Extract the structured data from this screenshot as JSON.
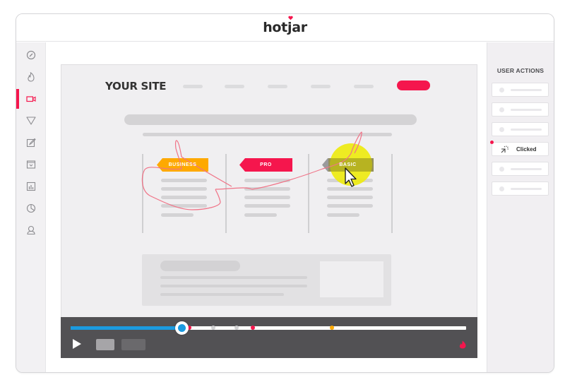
{
  "app": {
    "logo_text_pre": "hot",
    "logo_text_j": "j",
    "logo_text_post": "ar",
    "brand_color": "#f5164d"
  },
  "sidebar": {
    "items": [
      {
        "icon": "dashboard-gauge-icon",
        "active": false
      },
      {
        "icon": "heatmap-flame-icon",
        "active": false
      },
      {
        "icon": "recordings-camera-icon",
        "active": true
      },
      {
        "icon": "funnel-icon",
        "active": false
      },
      {
        "icon": "form-edit-icon",
        "active": false
      },
      {
        "icon": "poll-icon",
        "active": false
      },
      {
        "icon": "bar-chart-icon",
        "active": false
      },
      {
        "icon": "pie-chart-icon",
        "active": false
      },
      {
        "icon": "user-icon",
        "active": false
      }
    ]
  },
  "site": {
    "title": "YOUR SITE",
    "plans": [
      {
        "label": "BUSINESS",
        "color": "#fea900"
      },
      {
        "label": "PRO",
        "color": "#f5164d"
      },
      {
        "label": "BASIC",
        "color": "#9a9a9c"
      }
    ]
  },
  "player": {
    "progress": 0.28,
    "accent": "#1b9ae0",
    "markers": [
      {
        "pos": 0.3,
        "color": "#f5164d"
      },
      {
        "pos": 0.36,
        "color": "#cfcfd1"
      },
      {
        "pos": 0.42,
        "color": "#cfcfd1"
      },
      {
        "pos": 0.46,
        "color": "#f5164d"
      },
      {
        "pos": 0.66,
        "color": "#fea900"
      }
    ]
  },
  "user_actions": {
    "title": "USER ACTIONS",
    "items": [
      {
        "label": "",
        "type": "placeholder"
      },
      {
        "label": "",
        "type": "placeholder"
      },
      {
        "label": "",
        "type": "placeholder"
      },
      {
        "label": "Clicked",
        "type": "click",
        "current": true
      },
      {
        "label": "",
        "type": "placeholder"
      },
      {
        "label": "",
        "type": "placeholder"
      }
    ]
  }
}
